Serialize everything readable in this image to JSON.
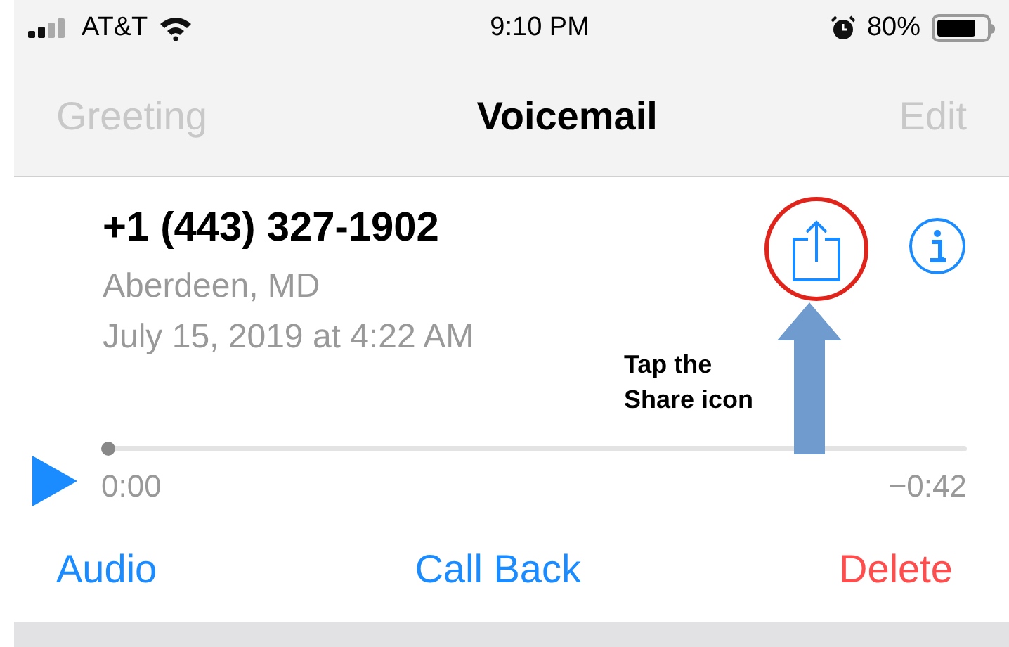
{
  "status_bar": {
    "carrier": "AT&T",
    "time": "9:10 PM",
    "battery": "80%"
  },
  "nav": {
    "left": {
      "label": "Greeting",
      "disabled": true
    },
    "title": "Voicemail",
    "right": {
      "label": "Edit",
      "disabled": true
    }
  },
  "voicemail": {
    "number": "+1 (443) 327-1902",
    "location": "Aberdeen, MD",
    "date": "July 15, 2019 at 4:22 AM"
  },
  "player": {
    "level": 0,
    "elapsed": "0:00",
    "remaining": "−0:42"
  },
  "actions": [
    {
      "label": "Audio",
      "kind": "normal"
    },
    {
      "label": "Call Back",
      "kind": "normal"
    },
    {
      "label": "Delete",
      "kind": "destructive"
    }
  ],
  "annotation": {
    "text": "Tap the Share icon"
  }
}
